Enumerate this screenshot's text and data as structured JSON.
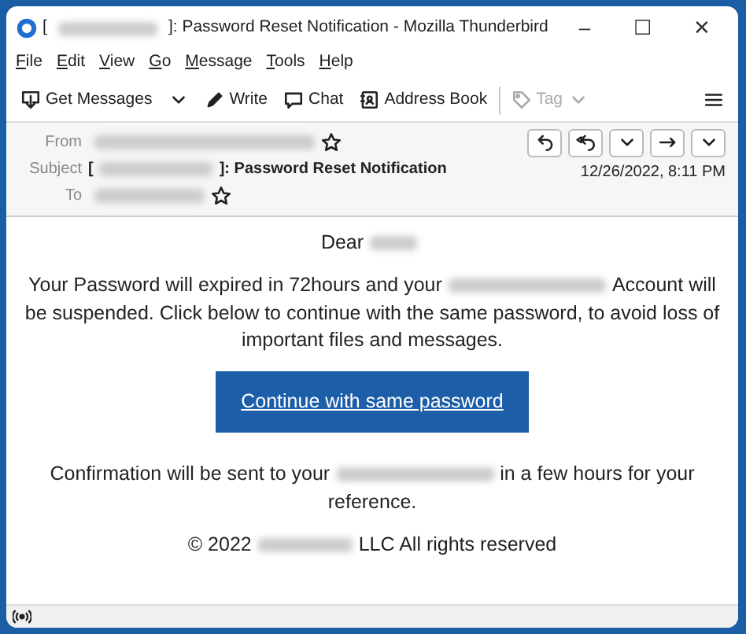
{
  "window": {
    "title": [
      {
        "kind": "text",
        "text": "["
      },
      {
        "kind": "redacted"
      },
      {
        "kind": "text",
        "text": "]: Password Reset Notification - Mozilla Thunderbird"
      }
    ],
    "controls": [
      "–",
      "☐",
      "✕"
    ]
  },
  "menu": [
    "File",
    "Edit",
    "View",
    "Go",
    "Message",
    "Tools",
    "Help"
  ],
  "toolbar": [
    {
      "kind": "button",
      "label": "Get Messages"
    },
    {
      "kind": "dropdown"
    },
    {
      "kind": "button",
      "label": "Write"
    },
    {
      "kind": "button",
      "label": "Chat"
    },
    {
      "kind": "button",
      "label": "Address Book"
    },
    {
      "kind": "separator"
    },
    {
      "kind": "menu",
      "label": "Tag",
      "disabled": true
    },
    {
      "kind": "spacer"
    },
    {
      "kind": "hamburger"
    }
  ],
  "header": {
    "from_label": "From",
    "subject": {
      "label": "Subject",
      "parts": [
        {
          "kind": "text",
          "text": "["
        },
        {
          "kind": "redacted"
        },
        {
          "kind": "text",
          "text": "]: Password Reset Notification"
        }
      ]
    },
    "to_label": "To",
    "date": "12/26/2022, 8:11 PM"
  },
  "body": {
    "paragraphs": [
      [
        [
          {
            "kind": "text",
            "text": "Dear"
          },
          {
            "kind": "redacted"
          }
        ]
      ],
      [
        [
          {
            "kind": "text",
            "text": "Your Password will expired  in 72hours and your"
          },
          {
            "kind": "redacted"
          },
          {
            "kind": "text",
            "text": "Account will"
          }
        ],
        [
          {
            "kind": "text",
            "text": "be suspended. Click below to continue with the same password, to avoid loss of"
          }
        ],
        [
          {
            "kind": "text",
            "text": "important files and messages."
          }
        ]
      ]
    ],
    "button": "Continue with same password",
    "after": [
      [
        [
          {
            "kind": "text",
            "text": "Confirmation will be sent to your"
          },
          {
            "kind": "redacted"
          },
          {
            "kind": "text",
            "text": "in a few hours for your"
          }
        ],
        [
          {
            "kind": "text",
            "text": "reference."
          }
        ]
      ],
      [
        [
          {
            "kind": "text",
            "text": "© 2022"
          },
          {
            "kind": "redacted"
          },
          {
            "kind": "text",
            "text": "LLC All rights reserved"
          }
        ]
      ]
    ]
  }
}
